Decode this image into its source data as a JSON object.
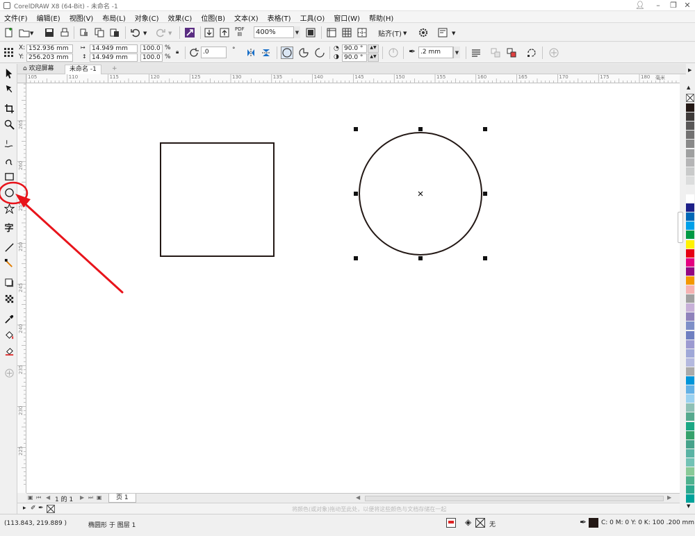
{
  "window": {
    "title": "CorelDRAW X8 (64-Bit) - 未命名 -1"
  },
  "menu": [
    "文件(F)",
    "编辑(E)",
    "视图(V)",
    "布局(L)",
    "对象(C)",
    "效果(C)",
    "位图(B)",
    "文本(X)",
    "表格(T)",
    "工具(O)",
    "窗口(W)",
    "帮助(H)"
  ],
  "toolbar": {
    "zoom": "400%",
    "snap_label": "贴齐(T)",
    "pdf_label": "PDF"
  },
  "properties": {
    "x": "152.936 mm",
    "y": "256.203 mm",
    "width": "14.949 mm",
    "height": "14.949 mm",
    "scale_x": "100.0",
    "scale_y": "100.0",
    "pct": "%",
    "rotation": ".0",
    "degree_sign": "°",
    "angle_start": "90.0 °",
    "angle_end": "90.0 °",
    "outline": ".2 mm"
  },
  "tabs": {
    "welcome": "欢迎屏幕",
    "document": "未命名 -1"
  },
  "ruler": {
    "h_labels": [
      "105",
      "110",
      "115",
      "120",
      "125",
      "130",
      "135",
      "140",
      "145",
      "150",
      "155",
      "160",
      "165",
      "170",
      "175",
      "180"
    ],
    "h_unit": "毫米",
    "v_labels": [
      "265",
      "260",
      "255",
      "250",
      "245",
      "240",
      "235",
      "230",
      "225"
    ]
  },
  "pagenav": {
    "page_count": "1 的 1",
    "page_tab": "页 1"
  },
  "colortray": {
    "hint": "将颜色(或对象)拖动至此处，以便将这些颜色与文档存储在一起"
  },
  "status": {
    "coords": "(113.843, 219.889 )",
    "object_info": "椭圆形 于 图层 1",
    "fill_none": "无",
    "color_info": "C: 0 M: 0 Y: 0 K: 100  .200 mm"
  },
  "palette_colors": [
    "#231815",
    "#3e3a39",
    "#595757",
    "#727171",
    "#898989",
    "#9fa0a0",
    "#b5b5b6",
    "#c9caca",
    "#dcdddd",
    "#efefef",
    "#ffffff",
    "#1d2088",
    "#0068b7",
    "#00a0e9",
    "#009944",
    "#fff100",
    "#e60012",
    "#e4007f",
    "#920783",
    "#f39800",
    "#f5b2b2",
    "#a0a0a0",
    "#c7b0d8",
    "#8f82bc",
    "#7e8fc8",
    "#6f7fc1",
    "#9c9ad1",
    "#9fa8d8",
    "#b4b9df",
    "#aaaaaa",
    "#0095d9",
    "#63b1e5",
    "#9ad1f0",
    "#8fc1b6",
    "#56a98e",
    "#1ba784",
    "#35a16b",
    "#46a28b",
    "#5ab3a4",
    "#72c2b5",
    "#89c997",
    "#4eb18e",
    "#2ca98f",
    "#00a29a"
  ],
  "colors": {
    "annotation": "#e8141b",
    "shape_stroke": "#231815"
  }
}
